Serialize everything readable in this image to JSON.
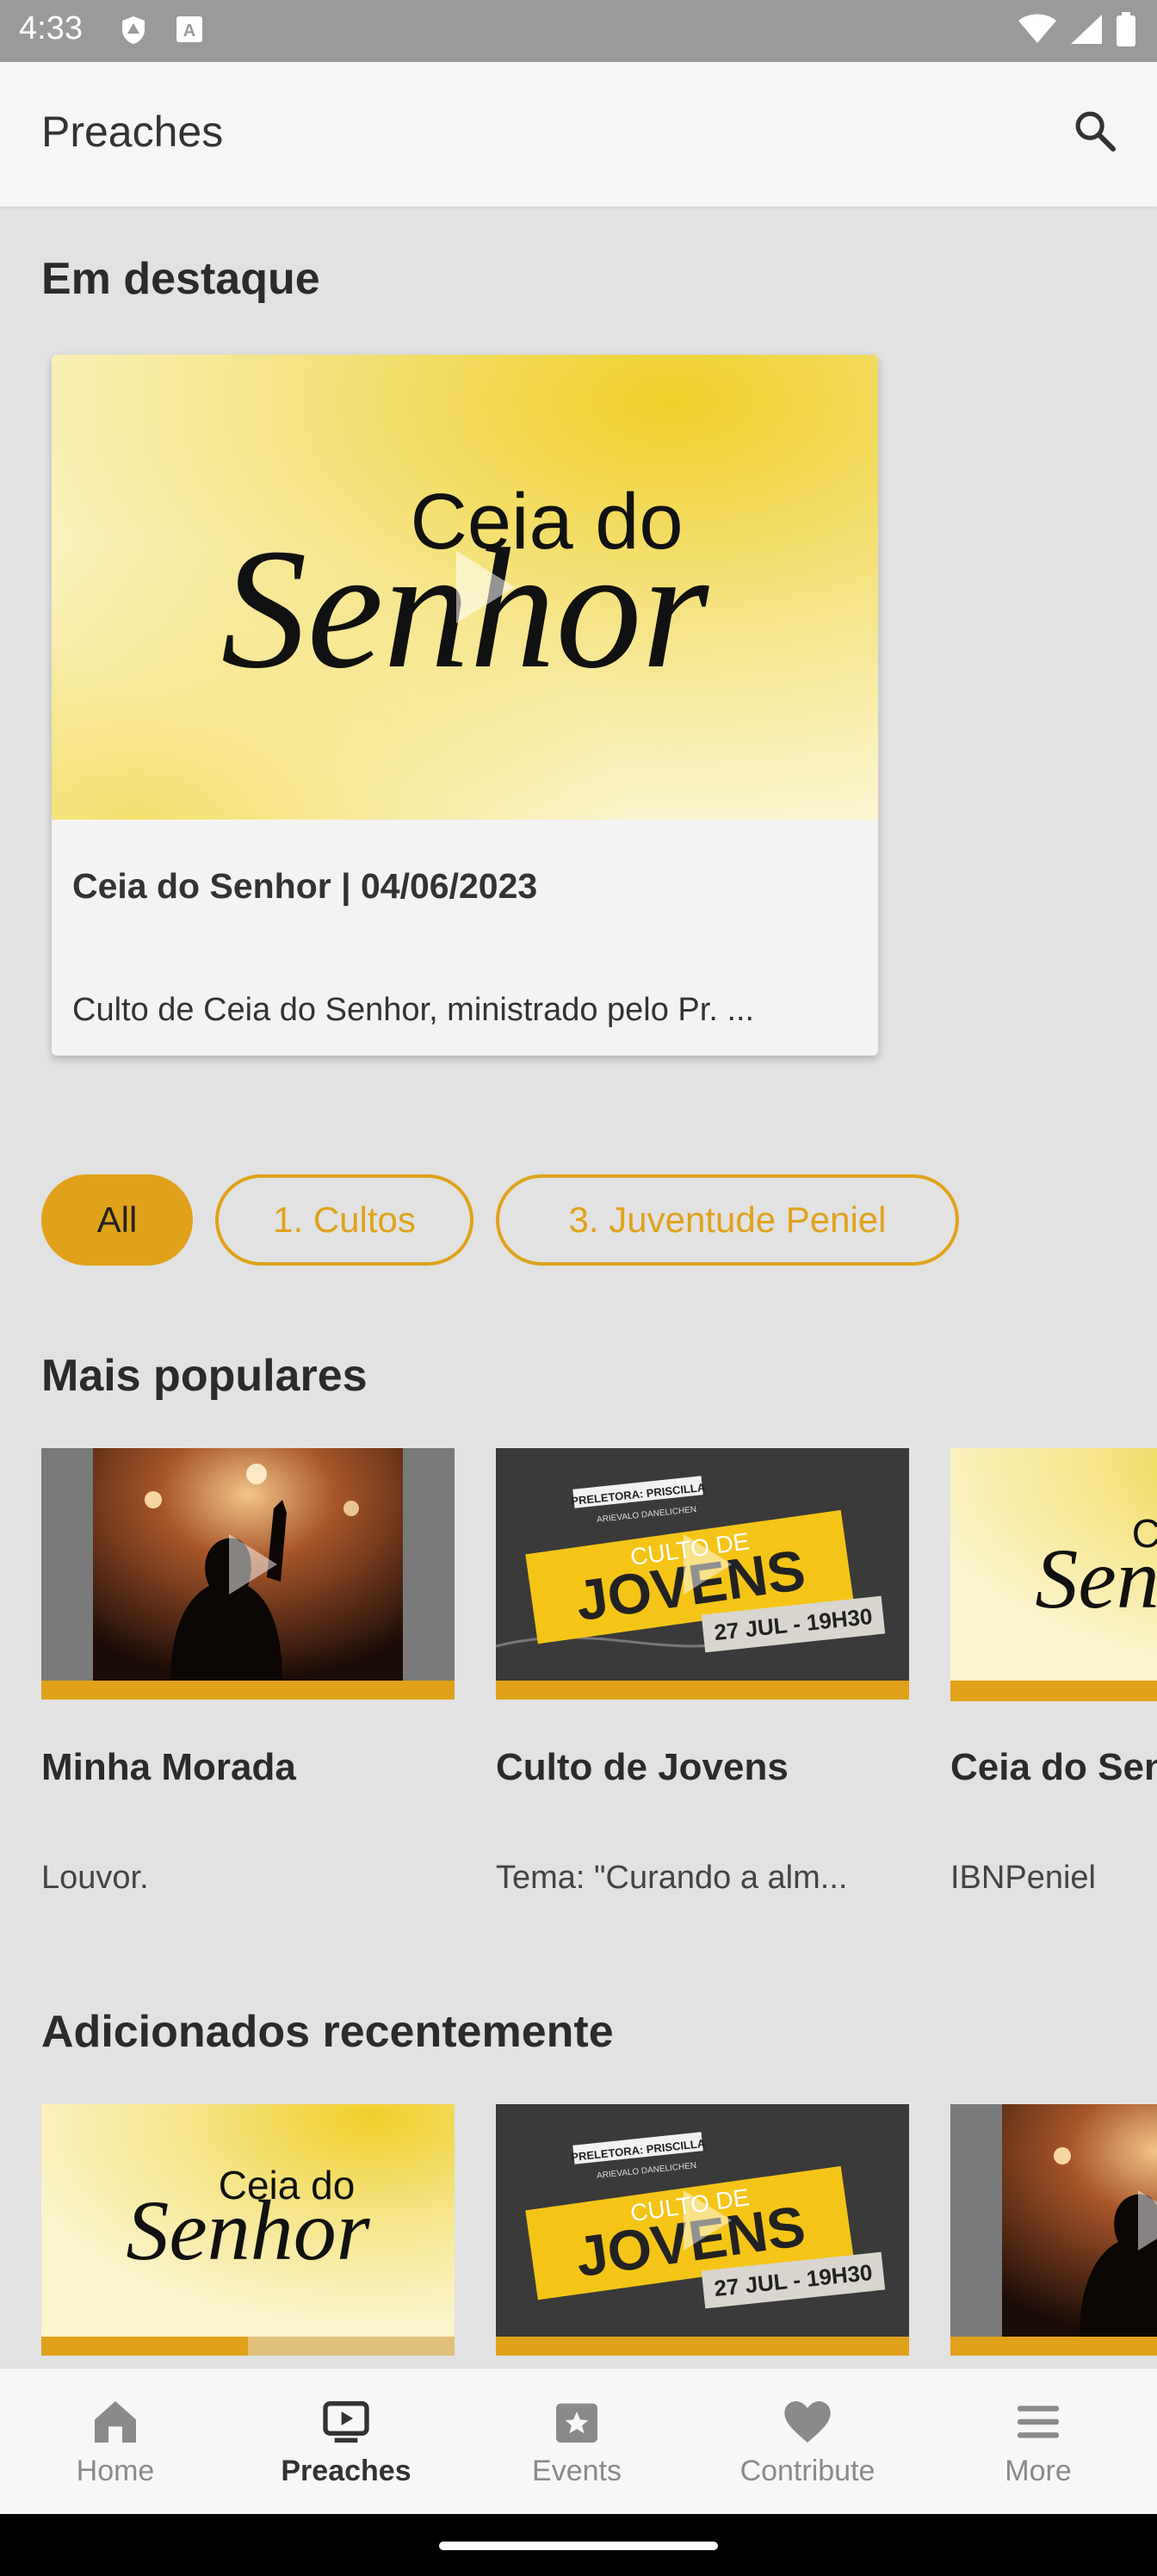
{
  "status_bar": {
    "time": "4:33"
  },
  "app_bar": {
    "title": "Preaches",
    "search_icon": "search-icon"
  },
  "featured": {
    "section_title": "Em destaque",
    "card": {
      "thumb_text_top": "Ceia do",
      "thumb_text_bottom": "Senhor",
      "title": "Ceia do Senhor | 04/06/2023",
      "description": "Culto de Ceia do Senhor, ministrado pelo Pr. ..."
    }
  },
  "filters": [
    {
      "label": "All",
      "selected": true
    },
    {
      "label": "1. Cultos",
      "selected": false
    },
    {
      "label": "3. Juventude Peniel",
      "selected": false
    }
  ],
  "popular": {
    "section_title": "Mais populares",
    "items": [
      {
        "title": "Minha Morada",
        "subtitle": "Louvor.",
        "progress": 1.0
      },
      {
        "title": "Culto de Jovens",
        "subtitle": "Tema: \"Curando a alm...",
        "progress": 1.0,
        "poster_small": "PRELETORA: PRISCILLA",
        "poster_name": "ARIEVALO DANELICHEN",
        "poster_top": "CULTO DE",
        "poster_main": "JOVENS",
        "poster_date": "27 JUL - 19H30"
      },
      {
        "title": "Ceia do Senhor",
        "subtitle": "IBNPeniel",
        "progress": 1.0,
        "thumb_text_top": "Ceia do",
        "thumb_text_bottom": "Senhor"
      }
    ]
  },
  "recent": {
    "section_title": "Adicionados recentemente",
    "items": [
      {
        "progress": 0.5,
        "thumb_text_top": "Ceia do",
        "thumb_text_bottom": "Senhor"
      },
      {
        "progress": 1.0,
        "poster_small": "PRELETORA: PRISCILLA",
        "poster_name": "ARIEVALO DANELICHEN",
        "poster_top": "CULTO DE",
        "poster_main": "JOVENS",
        "poster_date": "27 JUL - 19H30"
      },
      {
        "progress": 1.0
      }
    ]
  },
  "bottom_nav": [
    {
      "label": "Home",
      "icon": "home-icon",
      "active": false
    },
    {
      "label": "Preaches",
      "icon": "video-library-icon",
      "active": true
    },
    {
      "label": "Events",
      "icon": "event-star-icon",
      "active": false
    },
    {
      "label": "Contribute",
      "icon": "heart-icon",
      "active": false
    },
    {
      "label": "More",
      "icon": "menu-icon",
      "active": false
    }
  ],
  "colors": {
    "accent": "#e0a21a",
    "background": "#e2e2e2"
  }
}
